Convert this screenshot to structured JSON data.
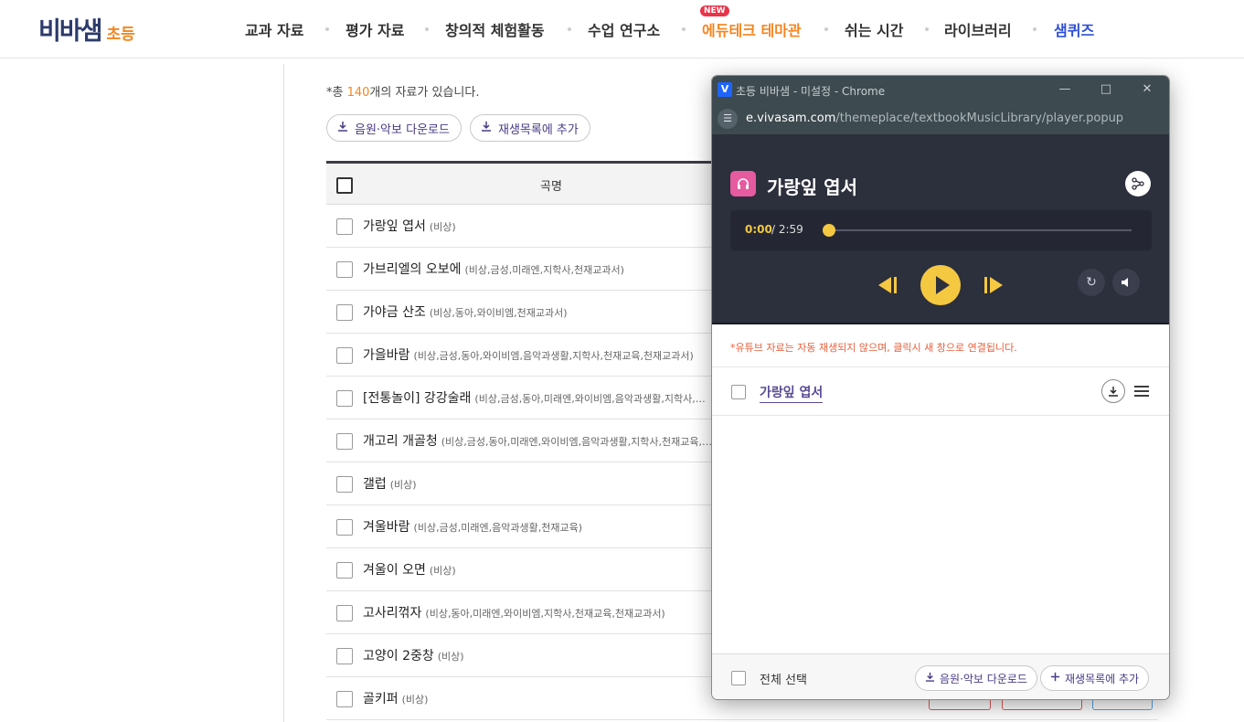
{
  "header": {
    "logo_main": "비바샘",
    "logo_sub": "초등",
    "nav": [
      "교과 자료",
      "평가 자료",
      "창의적 체험활동",
      "수업 연구소",
      "에듀테크 테마관",
      "쉬는 시간",
      "라이브러리",
      "샘퀴즈"
    ],
    "new_badge": "NEW"
  },
  "content": {
    "count_prefix": "*총 ",
    "count_num": "140",
    "count_suffix": "개의 자료가 있습니다.",
    "btn_download": "음원·악보 다운로드",
    "btn_add_playlist": "재생목록에 추가",
    "table_header_title": "곡명",
    "rows": [
      {
        "title": "가랑잎 엽서",
        "pub": "(비상)"
      },
      {
        "title": "가브리엘의 오보에",
        "pub": "(비상,금성,미래엔,지학사,천재교과서)"
      },
      {
        "title": "가야금 산조",
        "pub": "(비상,동아,와이비엠,천재교과서)"
      },
      {
        "title": "가을바람",
        "pub": "(비상,금성,동아,와이비엠,음악과생활,지학사,천재교육,천재교과서)"
      },
      {
        "title": "[전통놀이] 강강술래",
        "pub": "(비상,금성,동아,미래엔,와이비엠,음악과생활,지학사,…"
      },
      {
        "title": "개고리 개골청",
        "pub": "(비상,금성,동아,미래엔,와이비엠,음악과생활,지학사,천재교육,…"
      },
      {
        "title": "갤럽",
        "pub": "(비상)"
      },
      {
        "title": "겨울바람",
        "pub": "(비상,금성,미래엔,음악과생활,천재교육)"
      },
      {
        "title": "겨울이 오면",
        "pub": "(비상)"
      },
      {
        "title": "고사리꺾자",
        "pub": "(비상,동아,미래엔,와이비엠,지학사,천재교육,천재교과서)"
      },
      {
        "title": "고양이 2중창",
        "pub": "(비상)"
      },
      {
        "title": "골키퍼",
        "pub": "(비상)"
      }
    ]
  },
  "popup": {
    "window_title": "초등 비바샘 - 미설정 - Chrome",
    "url_domain": "e.vivasam.com",
    "url_path": "/themeplace/textbookMusicLibrary/player.popup",
    "song_title": "가랑잎 엽서",
    "time_current": "0:00",
    "time_total": " / 2:59",
    "progress": 0,
    "notice": "*유튜브 자료는 자동 재생되지 않으며, 클릭시 새 창으로 연결됩니다.",
    "playlist": [
      {
        "title": "가랑잎 엽서"
      }
    ],
    "select_all": "전체 선택",
    "btn_download": "음원·악보 다운로드",
    "btn_add_playlist": "재생목록에 추가"
  },
  "colors": {
    "accent_orange": "#f4851f",
    "accent_blue": "#2e4fd6",
    "player_bg": "#2c2f3c",
    "player_yellow": "#f5c842",
    "button_purple": "#4a3b86"
  }
}
